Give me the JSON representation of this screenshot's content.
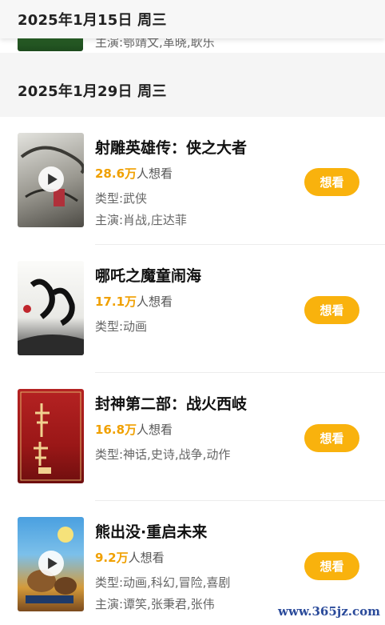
{
  "header": {
    "date": "2025年1月15日 周三"
  },
  "prev": {
    "cast_text": "主演:鄂靖文,革晓,耿乐"
  },
  "section": {
    "date": "2025年1月29日 周三"
  },
  "movies": [
    {
      "title": "射雕英雄传：侠之大者",
      "want_count": "28.6万",
      "want_suffix": "人想看",
      "genre": "类型:武侠",
      "cast": "主演:肖战,庄达菲",
      "button": "想看",
      "has_play": true,
      "poster_colors": [
        "#d9d9d4",
        "#6b6a64"
      ]
    },
    {
      "title": "哪吒之魔童闹海",
      "want_count": "17.1万",
      "want_suffix": "人想看",
      "genre": "类型:动画",
      "cast": "",
      "button": "想看",
      "has_play": false,
      "poster_colors": [
        "#f4f4f1",
        "#2b2b2b"
      ]
    },
    {
      "title": "封神第二部：战火西岐",
      "want_count": "16.8万",
      "want_suffix": "人想看",
      "genre": "类型:神话,史诗,战争,动作",
      "cast": "",
      "button": "想看",
      "has_play": false,
      "poster_colors": [
        "#b31f1f",
        "#7d1212"
      ]
    },
    {
      "title": "熊出没·重启未来",
      "want_count": "9.2万",
      "want_suffix": "人想看",
      "genre": "类型:动画,科幻,冒险,喜剧",
      "cast": "主演:谭笑,张秉君,张伟",
      "button": "想看",
      "has_play": true,
      "poster_colors": [
        "#3a87c9",
        "#d6892b"
      ]
    }
  ],
  "watermark": "www.365jz.com",
  "colors": {
    "accent": "#f9b20d",
    "want_number": "#f0a000"
  }
}
